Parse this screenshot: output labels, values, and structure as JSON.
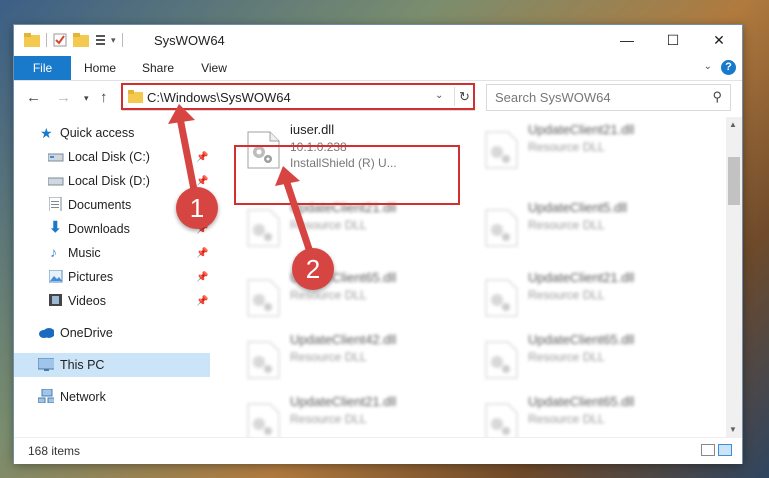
{
  "window": {
    "title": "SysWOW64",
    "controls": {
      "minimize": "—",
      "maximize": "☐",
      "close": "✕"
    }
  },
  "ribbon": {
    "tabs": [
      "File",
      "Home",
      "Share",
      "View"
    ],
    "help": "?"
  },
  "nav": {
    "path": "C:\\Windows\\SysWOW64",
    "search_placeholder": "Search SysWOW64"
  },
  "sidebar": {
    "items": [
      {
        "label": "Quick access",
        "icon": "star-icon",
        "pinned": false
      },
      {
        "label": "Local Disk (C:)",
        "icon": "drive-icon",
        "pinned": true
      },
      {
        "label": "Local Disk (D:)",
        "icon": "drive-icon",
        "pinned": true
      },
      {
        "label": "Documents",
        "icon": "documents-icon",
        "pinned": true
      },
      {
        "label": "Downloads",
        "icon": "download-icon",
        "pinned": true
      },
      {
        "label": "Music",
        "icon": "music-icon",
        "pinned": true
      },
      {
        "label": "Pictures",
        "icon": "pictures-icon",
        "pinned": true
      },
      {
        "label": "Videos",
        "icon": "videos-icon",
        "pinned": true
      },
      {
        "label": "OneDrive",
        "icon": "cloud-icon",
        "pinned": false
      },
      {
        "label": "This PC",
        "icon": "computer-icon",
        "pinned": false,
        "selected": true
      },
      {
        "label": "Network",
        "icon": "network-icon",
        "pinned": false
      }
    ]
  },
  "files": [
    {
      "name": "iuser.dll",
      "version": "10.1.0.238",
      "description": "InstallShield (R) U...",
      "highlighted": true
    },
    {
      "name": "UpdateClient21.dll",
      "version": "",
      "description": "Resource DLL"
    },
    {
      "name": "UpdateClient21.dll",
      "version": "",
      "description": "Resource DLL"
    },
    {
      "name": "UpdateClient5.dll",
      "version": "",
      "description": "Resource DLL"
    },
    {
      "name": "UpdateClient65.dll",
      "version": "",
      "description": "Resource DLL"
    },
    {
      "name": "UpdateClient21.dll",
      "version": "",
      "description": "Resource DLL"
    },
    {
      "name": "UpdateClient42.dll",
      "version": "",
      "description": "Resource DLL"
    },
    {
      "name": "UpdateClient65.dll",
      "version": "",
      "description": "Resource DLL"
    },
    {
      "name": "UpdateClient21.dll",
      "version": "",
      "description": "Resource DLL"
    },
    {
      "name": "UpdateClient65.dll",
      "version": "",
      "description": "Resource DLL"
    }
  ],
  "status": {
    "item_count": "168 items"
  },
  "annotations": {
    "step1": "1",
    "step2": "2"
  },
  "colors": {
    "accent": "#1979ca",
    "highlight": "#d32f2f",
    "selected": "#cce4f7"
  }
}
